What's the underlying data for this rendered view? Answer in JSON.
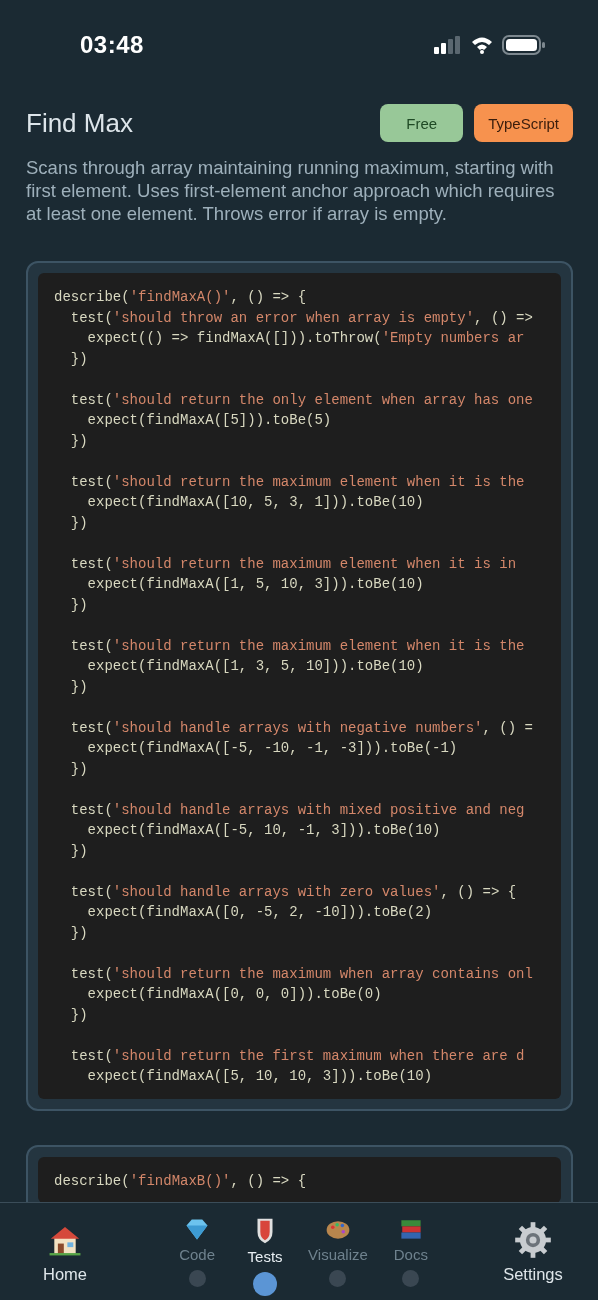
{
  "status_bar": {
    "time": "03:48"
  },
  "header": {
    "title": "Find Max",
    "badges": [
      {
        "label": "Free",
        "kind": "tier"
      },
      {
        "label": "TypeScript",
        "kind": "language"
      }
    ]
  },
  "description": "Scans through array maintaining running maximum, starting with first element. Uses first-element anchor approach which requires at least one element. Throws error if array is empty.",
  "code_blocks": [
    {
      "groups": [
        [
          [
            {
              "kind": "code",
              "text": "describe("
            },
            {
              "kind": "string",
              "text": "'findMaxA()'"
            },
            {
              "kind": "code",
              "text": ", () => {"
            }
          ],
          [
            {
              "kind": "code",
              "text": "  test("
            },
            {
              "kind": "string",
              "text": "'should throw an error when array is empty'"
            },
            {
              "kind": "code",
              "text": ", () =>"
            }
          ],
          [
            {
              "kind": "code",
              "text": "    expect(() => findMaxA([])).toThrow("
            },
            {
              "kind": "string",
              "text": "'Empty numbers ar"
            }
          ],
          [
            {
              "kind": "code",
              "text": "  })"
            }
          ]
        ],
        [
          [
            {
              "kind": "code",
              "text": "  test("
            },
            {
              "kind": "string",
              "text": "'should return the only element when array has one"
            }
          ],
          [
            {
              "kind": "code",
              "text": "    expect(findMaxA([5])).toBe(5)"
            }
          ],
          [
            {
              "kind": "code",
              "text": "  })"
            }
          ]
        ],
        [
          [
            {
              "kind": "code",
              "text": "  test("
            },
            {
              "kind": "string",
              "text": "'should return the maximum element when it is the"
            }
          ],
          [
            {
              "kind": "code",
              "text": "    expect(findMaxA([10, 5, 3, 1])).toBe(10)"
            }
          ],
          [
            {
              "kind": "code",
              "text": "  })"
            }
          ]
        ],
        [
          [
            {
              "kind": "code",
              "text": "  test("
            },
            {
              "kind": "string",
              "text": "'should return the maximum element when it is in"
            }
          ],
          [
            {
              "kind": "code",
              "text": "    expect(findMaxA([1, 5, 10, 3])).toBe(10)"
            }
          ],
          [
            {
              "kind": "code",
              "text": "  })"
            }
          ]
        ],
        [
          [
            {
              "kind": "code",
              "text": "  test("
            },
            {
              "kind": "string",
              "text": "'should return the maximum element when it is the"
            }
          ],
          [
            {
              "kind": "code",
              "text": "    expect(findMaxA([1, 3, 5, 10])).toBe(10)"
            }
          ],
          [
            {
              "kind": "code",
              "text": "  })"
            }
          ]
        ],
        [
          [
            {
              "kind": "code",
              "text": "  test("
            },
            {
              "kind": "string",
              "text": "'should handle arrays with negative numbers'"
            },
            {
              "kind": "code",
              "text": ", () ="
            }
          ],
          [
            {
              "kind": "code",
              "text": "    expect(findMaxA([-5, -10, -1, -3])).toBe(-1)"
            }
          ],
          [
            {
              "kind": "code",
              "text": "  })"
            }
          ]
        ],
        [
          [
            {
              "kind": "code",
              "text": "  test("
            },
            {
              "kind": "string",
              "text": "'should handle arrays with mixed positive and neg"
            }
          ],
          [
            {
              "kind": "code",
              "text": "    expect(findMaxA([-5, 10, -1, 3])).toBe(10)"
            }
          ],
          [
            {
              "kind": "code",
              "text": "  })"
            }
          ]
        ],
        [
          [
            {
              "kind": "code",
              "text": "  test("
            },
            {
              "kind": "string",
              "text": "'should handle arrays with zero values'"
            },
            {
              "kind": "code",
              "text": ", () => {"
            }
          ],
          [
            {
              "kind": "code",
              "text": "    expect(findMaxA([0, -5, 2, -10])).toBe(2)"
            }
          ],
          [
            {
              "kind": "code",
              "text": "  })"
            }
          ]
        ],
        [
          [
            {
              "kind": "code",
              "text": "  test("
            },
            {
              "kind": "string",
              "text": "'should return the maximum when array contains onl"
            }
          ],
          [
            {
              "kind": "code",
              "text": "    expect(findMaxA([0, 0, 0])).toBe(0)"
            }
          ],
          [
            {
              "kind": "code",
              "text": "  })"
            }
          ]
        ],
        [
          [
            {
              "kind": "code",
              "text": "  test("
            },
            {
              "kind": "string",
              "text": "'should return the first maximum when there are d"
            }
          ],
          [
            {
              "kind": "code",
              "text": "    expect(findMaxA([5, 10, 10, 3])).toBe(10)"
            }
          ]
        ]
      ]
    },
    {
      "groups": [
        [
          [
            {
              "kind": "code",
              "text": "describe("
            },
            {
              "kind": "string",
              "text": "'findMaxB()'"
            },
            {
              "kind": "code",
              "text": ", () => {"
            }
          ]
        ]
      ]
    }
  ],
  "tab_bar": {
    "items": [
      {
        "label": "Home",
        "kind": "main"
      },
      {
        "label": "Code",
        "kind": "sub",
        "selected": false
      },
      {
        "label": "Tests",
        "kind": "sub",
        "selected": true
      },
      {
        "label": "Visualize",
        "kind": "sub",
        "selected": false
      },
      {
        "label": "Docs",
        "kind": "sub",
        "selected": false
      },
      {
        "label": "Settings",
        "kind": "main"
      }
    ]
  }
}
